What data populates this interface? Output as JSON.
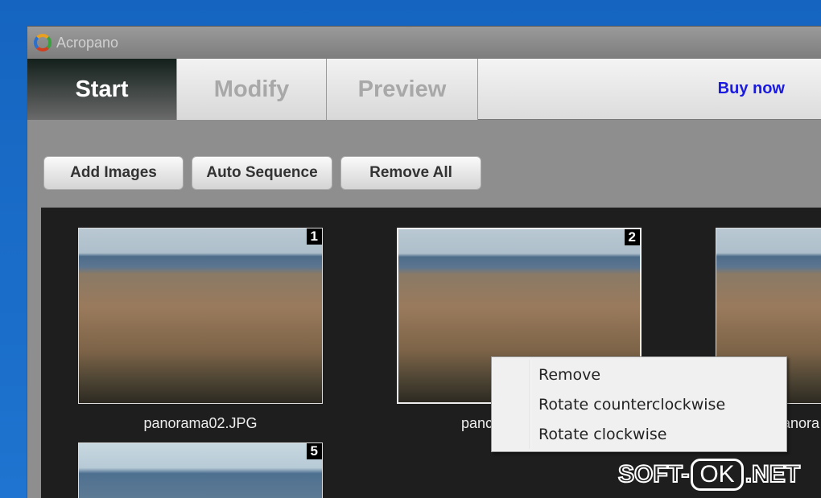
{
  "window": {
    "title": "Acropano"
  },
  "tabs": [
    {
      "label": "Start"
    },
    {
      "label": "Modify"
    },
    {
      "label": "Preview"
    }
  ],
  "buy_now": "Buy now",
  "toolbar": {
    "add": "Add Images",
    "auto": "Auto Sequence",
    "remove": "Remove All"
  },
  "thumbnails": [
    {
      "number": "1",
      "name": "panorama02.JPG"
    },
    {
      "number": "2",
      "name": "panc"
    },
    {
      "number": "",
      "name": "anora"
    },
    {
      "number": "5",
      "name": ""
    }
  ],
  "context_menu": [
    "Remove",
    "Rotate counterclockwise",
    "Rotate clockwise"
  ],
  "watermark": {
    "left": "SOFT-",
    "mid": "OK",
    "right": ".NET"
  }
}
